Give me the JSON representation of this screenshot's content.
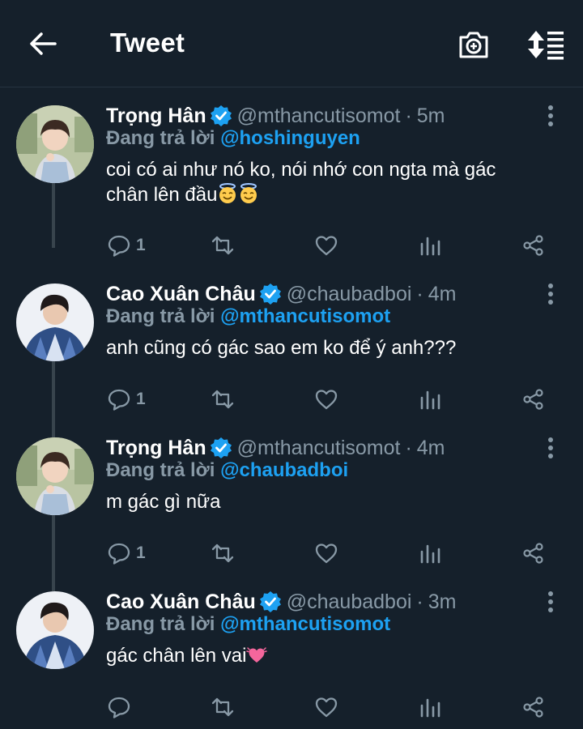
{
  "header": {
    "title": "Tweet"
  },
  "icons": {
    "back": "back-arrow-icon",
    "camera": "camera-add-icon",
    "sort": "sort-icon"
  },
  "colors": {
    "background": "#15202b",
    "accent": "#1da1f2",
    "secondary_text": "#8899a6",
    "thread_line": "#38444d"
  },
  "tweets": [
    {
      "name": "Trọng Hân",
      "handle": "@mthancutisomot",
      "time": "5m",
      "reply_label": "Đang trả lời",
      "reply_to": "@hoshinguyen",
      "text_line1": "coi có ai như nó ko, nói nhớ con ngta mà gác",
      "text_line2": "chân lên đầu",
      "emoji": "smiling-face-with-halo",
      "reply_count": "1"
    },
    {
      "name": "Cao Xuân Châu",
      "handle": "@chaubadboi",
      "time": "4m",
      "reply_label": "Đang trả lời",
      "reply_to": "@mthancutisomot",
      "text_line1": "anh cũng có gác sao em ko để ý anh???",
      "reply_count": "1"
    },
    {
      "name": "Trọng Hân",
      "handle": "@mthancutisomot",
      "time": "4m",
      "reply_label": "Đang trả lời",
      "reply_to": "@chaubadboi",
      "text_line1": "m gác gì nữa",
      "reply_count": "1"
    },
    {
      "name": "Cao Xuân Châu",
      "handle": "@chaubadboi",
      "time": "3m",
      "reply_label": "Đang trả lời",
      "reply_to": "@mthancutisomot",
      "text_line1": "gác chân lên vai",
      "emoji": "growing-heart",
      "reply_count": ""
    }
  ]
}
